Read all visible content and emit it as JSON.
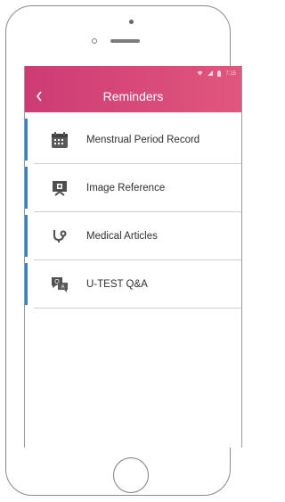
{
  "app": {
    "title": "Reminders",
    "back_icon": "chevron-left-icon"
  },
  "status": {
    "time": "7:15",
    "icons": [
      "wifi-icon",
      "signal-icon",
      "battery-icon"
    ]
  },
  "colors": {
    "appbar": "#d84a78",
    "accent": "#2d88c8",
    "text": "#2f2f2f"
  },
  "menu": [
    {
      "label": "Menstrual Period Record",
      "icon": "calendar-icon"
    },
    {
      "label": "Image Reference",
      "icon": "image-reference-icon"
    },
    {
      "label": "Medical Articles",
      "icon": "stethoscope-icon"
    },
    {
      "label": "U-TEST Q&A",
      "icon": "qa-chat-icon"
    }
  ]
}
